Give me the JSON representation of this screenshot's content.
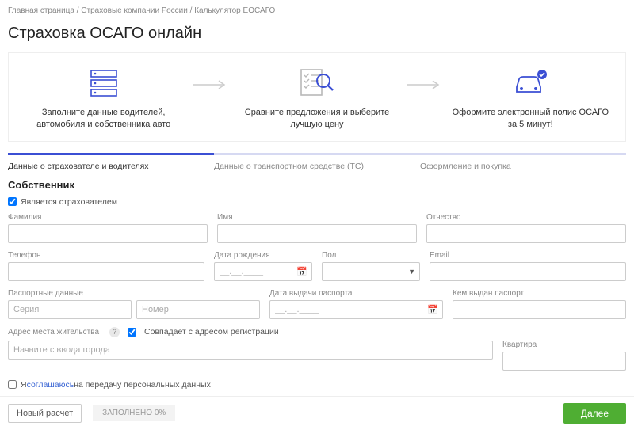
{
  "breadcrumb": {
    "home": "Главная страница",
    "companies": "Страховые компании России",
    "calc": "Калькулятор ЕОСАГО"
  },
  "page_title": "Страховка ОСАГО онлайн",
  "steps": {
    "s1": "Заполните данные водителей, автомобиля и собственника авто",
    "s2": "Сравните предложения и выберите лучшую цену",
    "s3": "Оформите электронный полис ОСАГО за 5 минут!"
  },
  "tabs": {
    "t1": "Данные о страхователе и водителях",
    "t2": "Данные о транспортном средстве (ТС)",
    "t3": "Оформление и покупка"
  },
  "owner": {
    "heading": "Собственник",
    "is_insurer_label": "Является страхователем",
    "lastname": "Фамилия",
    "firstname": "Имя",
    "patronymic": "Отчество",
    "phone": "Телефон",
    "dob": "Дата рождения",
    "dob_placeholder": "__.__.____",
    "gender": "Пол",
    "email": "Email",
    "passport": "Паспортные данные",
    "series_ph": "Серия",
    "number_ph": "Номер",
    "passport_date": "Дата выдачи паспорта",
    "passport_date_placeholder": "__.__.____",
    "passport_issued": "Кем выдан паспорт",
    "address_label": "Адрес места жительства",
    "same_as_reg": "Совпадает с адресом регистрации",
    "address_ph": "Начните с ввода города",
    "apartment": "Квартира"
  },
  "consent": {
    "prefix": "Я ",
    "link": "соглашаюсь",
    "suffix": " на передачу персональных данных"
  },
  "footer": {
    "reset": "Новый расчет",
    "status": "ЗАПОЛНЕНО 0%",
    "next": "Далее"
  }
}
